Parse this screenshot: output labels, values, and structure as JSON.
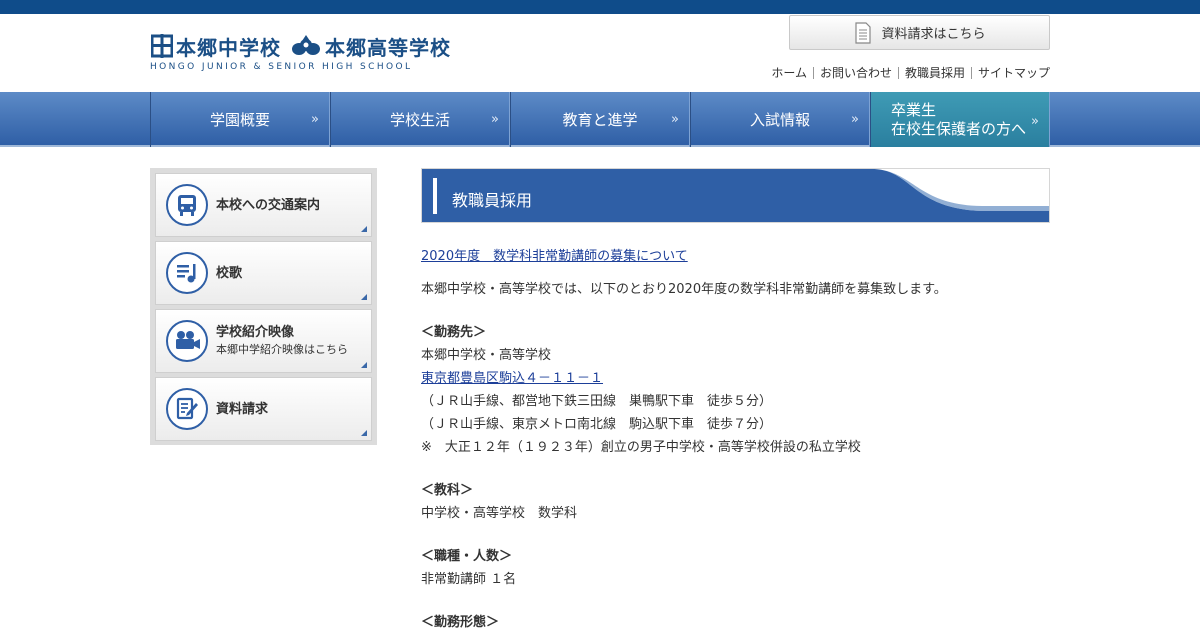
{
  "header": {
    "logo_jr": "本郷中学校",
    "logo_sr": "本郷高等学校",
    "logo_en": "HONGO JUNIOR & SENIOR HIGH SCHOOL",
    "request_button": "資料請求はこちら",
    "util_links": [
      "ホーム",
      "お問い合わせ",
      "教職員採用",
      "サイトマップ"
    ]
  },
  "nav": {
    "items": [
      "学園概要",
      "学校生活",
      "教育と進学",
      "入試情報"
    ],
    "alt_line1": "卒業生",
    "alt_line2": "在校生保護者の方へ",
    "arrow": "»"
  },
  "sidebar": {
    "items": [
      {
        "label": "本校への交通案内",
        "icon": "bus-icon"
      },
      {
        "label": "校歌",
        "icon": "music-note-icon"
      },
      {
        "label": "学校紹介映像",
        "sub": "本郷中学紹介映像はこちら",
        "icon": "video-camera-icon"
      },
      {
        "label": "資料請求",
        "icon": "document-pen-icon"
      }
    ]
  },
  "main": {
    "page_title": "教職員採用",
    "article_link": "2020年度　数学科非常勤講師の募集について",
    "intro": "本郷中学校・高等学校では、以下のとおり2020年度の数学科非常勤講師を募集致します。",
    "sections": {
      "workplace_h": "＜勤務先＞",
      "workplace_name": "本郷中学校・高等学校",
      "workplace_address": "東京都豊島区駒込４－１１－１",
      "access1": "（ＪＲ山手線、都営地下鉄三田線　巣鴨駅下車　徒歩５分）",
      "access2": "（ＪＲ山手線、東京メトロ南北線　駒込駅下車　徒歩７分）",
      "note": "※　大正１２年（１９２３年）創立の男子中学校・高等学校併設の私立学校",
      "subject_h": "＜教科＞",
      "subject": "中学校・高等学校　数学科",
      "position_h": "＜職種・人数＞",
      "position": "非常勤講師 １名",
      "form_h": "＜勤務形態＞"
    }
  },
  "colors": {
    "brand": "#1b4f86",
    "topbar": "#0f4c8a",
    "nav": "#2f5fa6",
    "nav_alt": "#2a7f9f",
    "link": "#1d3f99"
  }
}
